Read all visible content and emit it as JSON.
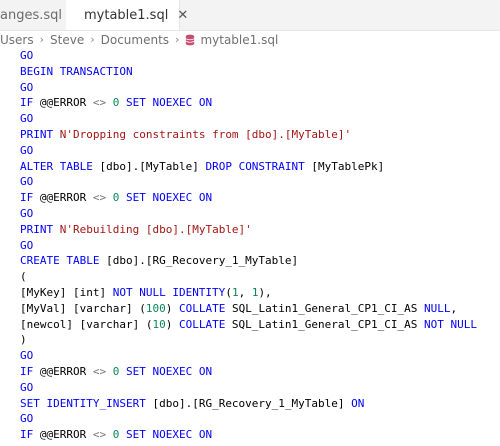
{
  "tabs": [
    {
      "label": "anges.sql",
      "active": false
    },
    {
      "label": "mytable1.sql",
      "active": true,
      "close": "✕"
    }
  ],
  "breadcrumb": {
    "items": [
      "Users",
      "Steve",
      "Documents"
    ],
    "separator": "›",
    "file": "mytable1.sql"
  },
  "colors": {
    "keyword": "#0000ff",
    "string": "#a31515",
    "number": "#098658",
    "operator": "#777777",
    "db_icon": "#c94b6d"
  },
  "code_lines": [
    [
      [
        "kw",
        "GO"
      ]
    ],
    [
      [
        "kw",
        "BEGIN TRANSACTION"
      ]
    ],
    [
      [
        "kw",
        "GO"
      ]
    ],
    [
      [
        "kw",
        "IF"
      ],
      [
        "tx",
        " @@ERROR "
      ],
      [
        "op",
        "<>"
      ],
      [
        "tx",
        " "
      ],
      [
        "num",
        "0"
      ],
      [
        "tx",
        " "
      ],
      [
        "kw",
        "SET NOEXEC ON"
      ]
    ],
    [
      [
        "kw",
        "GO"
      ]
    ],
    [
      [
        "kw",
        "PRINT"
      ],
      [
        "tx",
        " "
      ],
      [
        "str",
        "N'Dropping constraints from [dbo].[MyTable]'"
      ]
    ],
    [
      [
        "kw",
        "GO"
      ]
    ],
    [
      [
        "kw",
        "ALTER TABLE"
      ],
      [
        "tx",
        " [dbo].[MyTable] "
      ],
      [
        "kw",
        "DROP CONSTRAINT"
      ],
      [
        "tx",
        " [MyTablePk]"
      ]
    ],
    [
      [
        "kw",
        "GO"
      ]
    ],
    [
      [
        "kw",
        "IF"
      ],
      [
        "tx",
        " @@ERROR "
      ],
      [
        "op",
        "<>"
      ],
      [
        "tx",
        " "
      ],
      [
        "num",
        "0"
      ],
      [
        "tx",
        " "
      ],
      [
        "kw",
        "SET NOEXEC ON"
      ]
    ],
    [
      [
        "kw",
        "GO"
      ]
    ],
    [
      [
        "kw",
        "PRINT"
      ],
      [
        "tx",
        " "
      ],
      [
        "str",
        "N'Rebuilding [dbo].[MyTable]'"
      ]
    ],
    [
      [
        "kw",
        "GO"
      ]
    ],
    [
      [
        "kw",
        "CREATE TABLE"
      ],
      [
        "tx",
        " [dbo].[RG_Recovery_1_MyTable]"
      ]
    ],
    [
      [
        "tx",
        "("
      ]
    ],
    [
      [
        "tx",
        "[MyKey] [int] "
      ],
      [
        "kw",
        "NOT NULL IDENTITY"
      ],
      [
        "tx",
        "("
      ],
      [
        "num",
        "1"
      ],
      [
        "tx",
        ", "
      ],
      [
        "num",
        "1"
      ],
      [
        "tx",
        "),"
      ]
    ],
    [
      [
        "tx",
        "[MyVal] [varchar] ("
      ],
      [
        "num",
        "100"
      ],
      [
        "tx",
        ") "
      ],
      [
        "kw",
        "COLLATE"
      ],
      [
        "tx",
        " SQL_Latin1_General_CP1_CI_AS "
      ],
      [
        "kw",
        "NULL"
      ],
      [
        "tx",
        ","
      ]
    ],
    [
      [
        "tx",
        "[newcol] [varchar] ("
      ],
      [
        "num",
        "10"
      ],
      [
        "tx",
        ") "
      ],
      [
        "kw",
        "COLLATE"
      ],
      [
        "tx",
        " SQL_Latin1_General_CP1_CI_AS "
      ],
      [
        "kw",
        "NOT NULL"
      ]
    ],
    [
      [
        "tx",
        ")"
      ]
    ],
    [
      [
        "kw",
        "GO"
      ]
    ],
    [
      [
        "kw",
        "IF"
      ],
      [
        "tx",
        " @@ERROR "
      ],
      [
        "op",
        "<>"
      ],
      [
        "tx",
        " "
      ],
      [
        "num",
        "0"
      ],
      [
        "tx",
        " "
      ],
      [
        "kw",
        "SET NOEXEC ON"
      ]
    ],
    [
      [
        "kw",
        "GO"
      ]
    ],
    [
      [
        "kw",
        "SET IDENTITY_INSERT"
      ],
      [
        "tx",
        " [dbo].[RG_Recovery_1_MyTable] "
      ],
      [
        "kw",
        "ON"
      ]
    ],
    [
      [
        "kw",
        "GO"
      ]
    ],
    [
      [
        "kw",
        "IF"
      ],
      [
        "tx",
        " @@ERROR "
      ],
      [
        "op",
        "<>"
      ],
      [
        "tx",
        " "
      ],
      [
        "num",
        "0"
      ],
      [
        "tx",
        " "
      ],
      [
        "kw",
        "SET NOEXEC ON"
      ]
    ]
  ]
}
